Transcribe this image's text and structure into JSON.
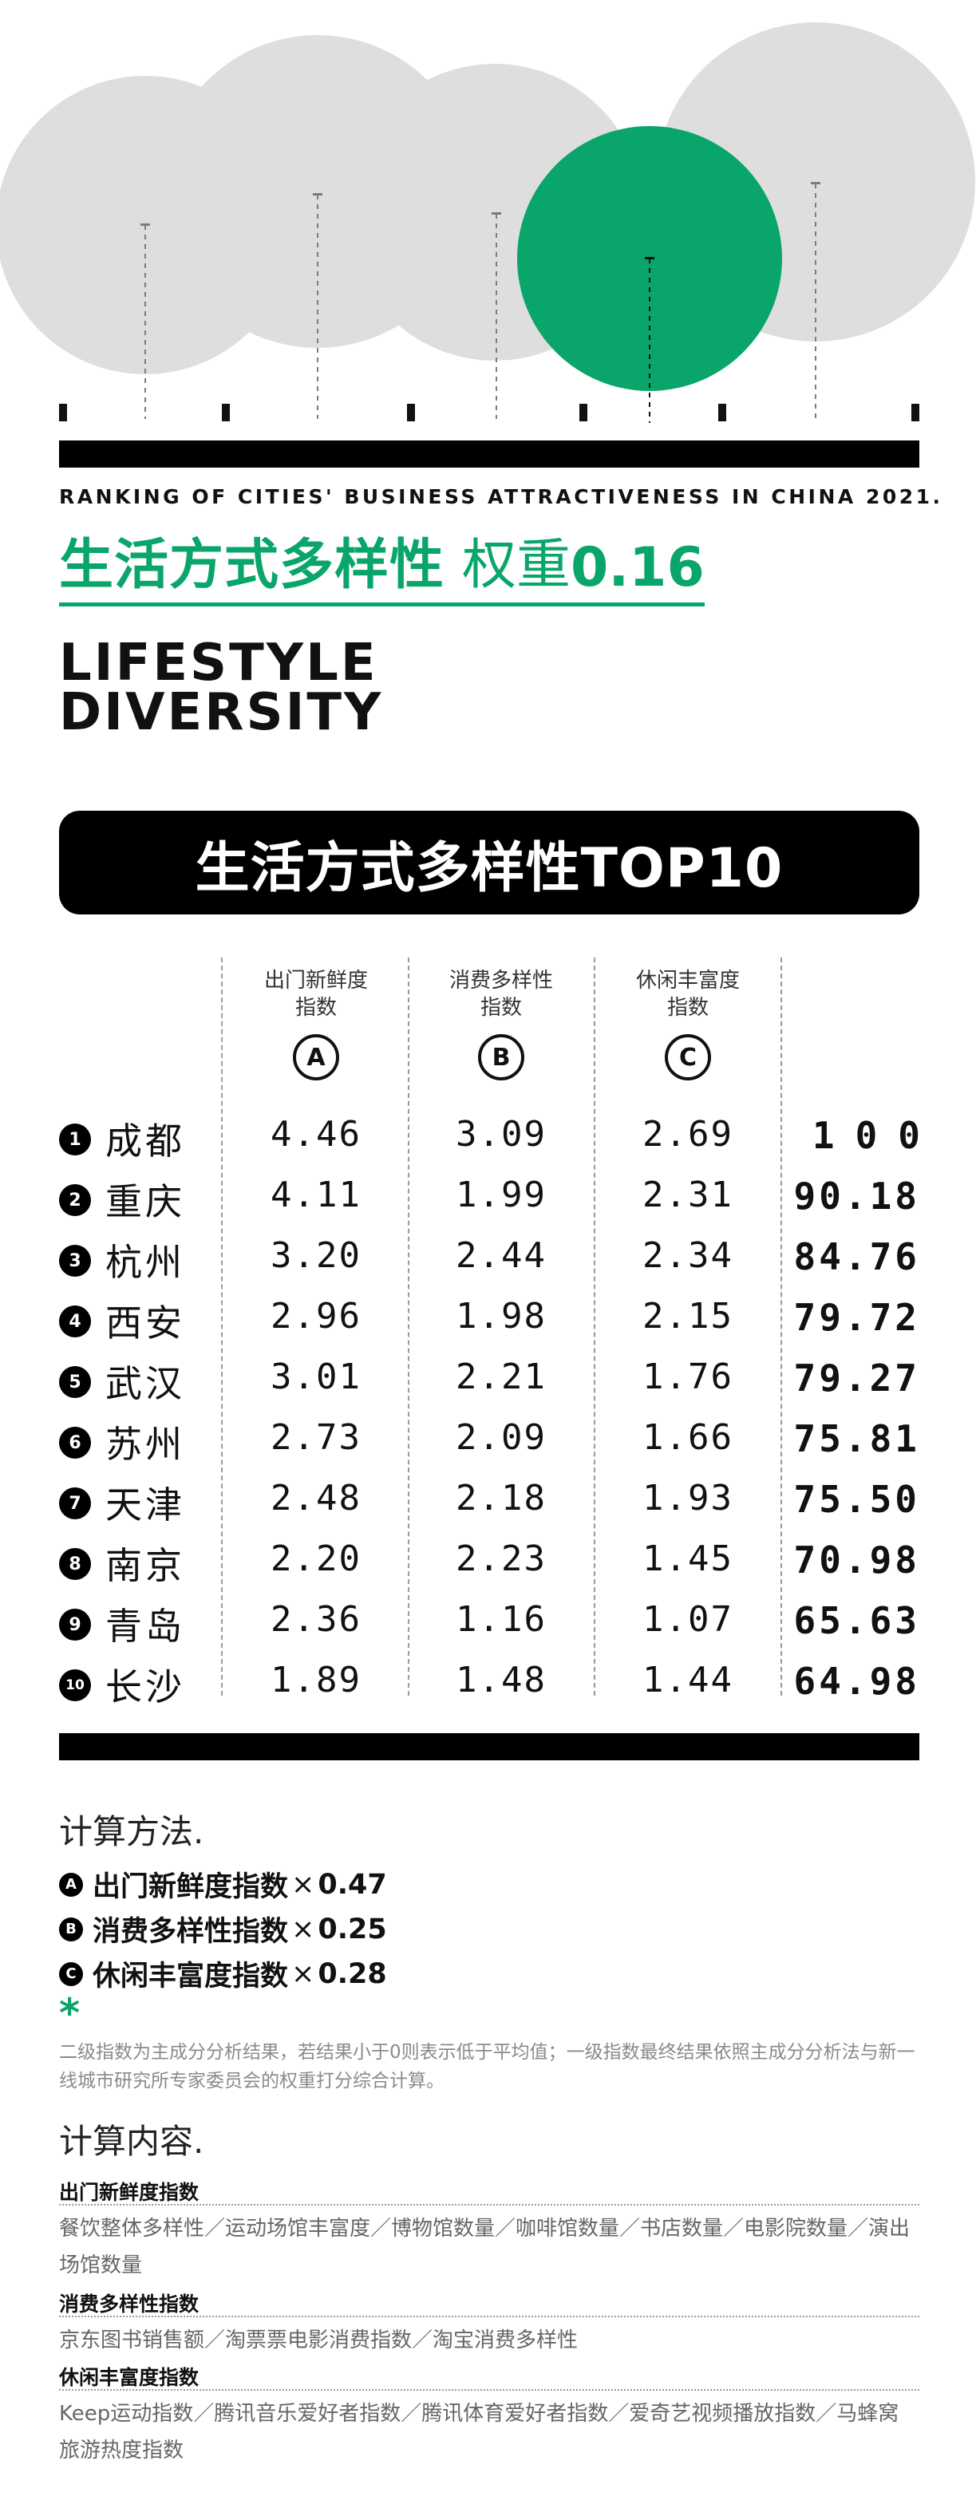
{
  "header": {
    "eyebrow": "RANKING OF CITIES'  BUSINESS ATTRACTIVENESS IN CHINA 2021.",
    "cn_title": "生活方式多样性",
    "weight_label": "权重",
    "weight_value": "0.16",
    "en_title_line1": "LIFESTYLE",
    "en_title_line2": "DIVERSITY"
  },
  "banner": {
    "title": "生活方式多样性TOP10"
  },
  "table": {
    "columns": [
      {
        "line1": "出门新鲜度",
        "line2": "指数",
        "letter": "A"
      },
      {
        "line1": "消费多样性",
        "line2": "指数",
        "letter": "B"
      },
      {
        "line1": "休闲丰富度",
        "line2": "指数",
        "letter": "C"
      }
    ],
    "rows": [
      {
        "rank": "1",
        "city": "成都",
        "a": "4.46",
        "b": "3.09",
        "c": "2.69",
        "total": "100"
      },
      {
        "rank": "2",
        "city": "重庆",
        "a": "4.11",
        "b": "1.99",
        "c": "2.31",
        "total": "90.18"
      },
      {
        "rank": "3",
        "city": "杭州",
        "a": "3.20",
        "b": "2.44",
        "c": "2.34",
        "total": "84.76"
      },
      {
        "rank": "4",
        "city": "西安",
        "a": "2.96",
        "b": "1.98",
        "c": "2.15",
        "total": "79.72"
      },
      {
        "rank": "5",
        "city": "武汉",
        "a": "3.01",
        "b": "2.21",
        "c": "1.76",
        "total": "79.27"
      },
      {
        "rank": "6",
        "city": "苏州",
        "a": "2.73",
        "b": "2.09",
        "c": "1.66",
        "total": "75.81"
      },
      {
        "rank": "7",
        "city": "天津",
        "a": "2.48",
        "b": "2.18",
        "c": "1.93",
        "total": "75.50"
      },
      {
        "rank": "8",
        "city": "南京",
        "a": "2.20",
        "b": "2.23",
        "c": "1.45",
        "total": "70.98"
      },
      {
        "rank": "9",
        "city": "青岛",
        "a": "2.36",
        "b": "1.16",
        "c": "1.07",
        "total": "65.63"
      },
      {
        "rank": "10",
        "city": "长沙",
        "a": "1.89",
        "b": "1.48",
        "c": "1.44",
        "total": "64.98"
      }
    ]
  },
  "method": {
    "title": "计算方法.",
    "formulas": [
      {
        "letter": "A",
        "name": "出门新鲜度指数",
        "times": "×",
        "weight": "0.47"
      },
      {
        "letter": "B",
        "name": "消费多样性指数",
        "times": "×",
        "weight": "0.25"
      },
      {
        "letter": "C",
        "name": "休闲丰富度指数",
        "times": "×",
        "weight": "0.28"
      }
    ],
    "asterisk": "*",
    "footnote": "二级指数为主成分分析结果，若结果小于0则表示低于平均值；一级指数最终结果依照主成分分析法与新一线城市研究所专家委员会的权重打分综合计算。"
  },
  "content": {
    "title": "计算内容.",
    "sections": [
      {
        "heading": "出门新鲜度指数",
        "body": "餐饮整体多样性／运动场馆丰富度／博物馆数量／咖啡馆数量／书店数量／电影院数量／演出场馆数量"
      },
      {
        "heading": "消费多样性指数",
        "body": "京东图书销售额／淘票票电影消费指数／淘宝消费多样性"
      },
      {
        "heading": "休闲丰富度指数",
        "body": "Keep运动指数／腾讯音乐爱好者指数／腾讯体育爱好者指数／爱奇艺视频播放指数／马蜂窝旅游热度指数"
      }
    ]
  },
  "colors": {
    "accent": "#0aa56a",
    "circle_grey": "#d6d6d6",
    "ink": "#000000"
  }
}
